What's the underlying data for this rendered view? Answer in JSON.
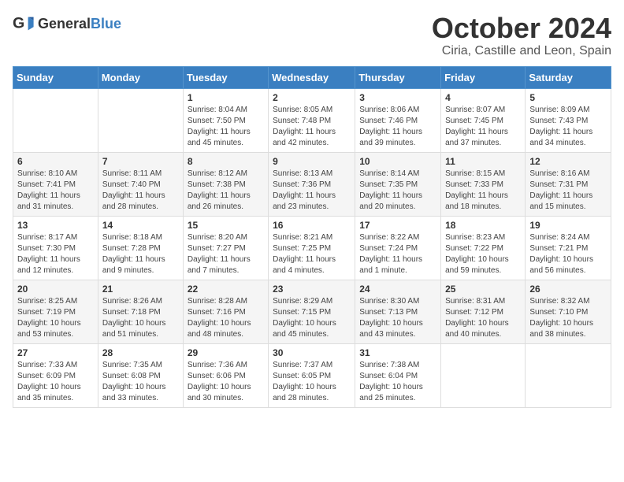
{
  "logo": {
    "text_general": "General",
    "text_blue": "Blue"
  },
  "header": {
    "month": "October 2024",
    "location": "Ciria, Castille and Leon, Spain"
  },
  "weekdays": [
    "Sunday",
    "Monday",
    "Tuesday",
    "Wednesday",
    "Thursday",
    "Friday",
    "Saturday"
  ],
  "weeks": [
    [
      {
        "day": "",
        "info": ""
      },
      {
        "day": "",
        "info": ""
      },
      {
        "day": "1",
        "info": "Sunrise: 8:04 AM\nSunset: 7:50 PM\nDaylight: 11 hours and 45 minutes."
      },
      {
        "day": "2",
        "info": "Sunrise: 8:05 AM\nSunset: 7:48 PM\nDaylight: 11 hours and 42 minutes."
      },
      {
        "day": "3",
        "info": "Sunrise: 8:06 AM\nSunset: 7:46 PM\nDaylight: 11 hours and 39 minutes."
      },
      {
        "day": "4",
        "info": "Sunrise: 8:07 AM\nSunset: 7:45 PM\nDaylight: 11 hours and 37 minutes."
      },
      {
        "day": "5",
        "info": "Sunrise: 8:09 AM\nSunset: 7:43 PM\nDaylight: 11 hours and 34 minutes."
      }
    ],
    [
      {
        "day": "6",
        "info": "Sunrise: 8:10 AM\nSunset: 7:41 PM\nDaylight: 11 hours and 31 minutes."
      },
      {
        "day": "7",
        "info": "Sunrise: 8:11 AM\nSunset: 7:40 PM\nDaylight: 11 hours and 28 minutes."
      },
      {
        "day": "8",
        "info": "Sunrise: 8:12 AM\nSunset: 7:38 PM\nDaylight: 11 hours and 26 minutes."
      },
      {
        "day": "9",
        "info": "Sunrise: 8:13 AM\nSunset: 7:36 PM\nDaylight: 11 hours and 23 minutes."
      },
      {
        "day": "10",
        "info": "Sunrise: 8:14 AM\nSunset: 7:35 PM\nDaylight: 11 hours and 20 minutes."
      },
      {
        "day": "11",
        "info": "Sunrise: 8:15 AM\nSunset: 7:33 PM\nDaylight: 11 hours and 18 minutes."
      },
      {
        "day": "12",
        "info": "Sunrise: 8:16 AM\nSunset: 7:31 PM\nDaylight: 11 hours and 15 minutes."
      }
    ],
    [
      {
        "day": "13",
        "info": "Sunrise: 8:17 AM\nSunset: 7:30 PM\nDaylight: 11 hours and 12 minutes."
      },
      {
        "day": "14",
        "info": "Sunrise: 8:18 AM\nSunset: 7:28 PM\nDaylight: 11 hours and 9 minutes."
      },
      {
        "day": "15",
        "info": "Sunrise: 8:20 AM\nSunset: 7:27 PM\nDaylight: 11 hours and 7 minutes."
      },
      {
        "day": "16",
        "info": "Sunrise: 8:21 AM\nSunset: 7:25 PM\nDaylight: 11 hours and 4 minutes."
      },
      {
        "day": "17",
        "info": "Sunrise: 8:22 AM\nSunset: 7:24 PM\nDaylight: 11 hours and 1 minute."
      },
      {
        "day": "18",
        "info": "Sunrise: 8:23 AM\nSunset: 7:22 PM\nDaylight: 10 hours and 59 minutes."
      },
      {
        "day": "19",
        "info": "Sunrise: 8:24 AM\nSunset: 7:21 PM\nDaylight: 10 hours and 56 minutes."
      }
    ],
    [
      {
        "day": "20",
        "info": "Sunrise: 8:25 AM\nSunset: 7:19 PM\nDaylight: 10 hours and 53 minutes."
      },
      {
        "day": "21",
        "info": "Sunrise: 8:26 AM\nSunset: 7:18 PM\nDaylight: 10 hours and 51 minutes."
      },
      {
        "day": "22",
        "info": "Sunrise: 8:28 AM\nSunset: 7:16 PM\nDaylight: 10 hours and 48 minutes."
      },
      {
        "day": "23",
        "info": "Sunrise: 8:29 AM\nSunset: 7:15 PM\nDaylight: 10 hours and 45 minutes."
      },
      {
        "day": "24",
        "info": "Sunrise: 8:30 AM\nSunset: 7:13 PM\nDaylight: 10 hours and 43 minutes."
      },
      {
        "day": "25",
        "info": "Sunrise: 8:31 AM\nSunset: 7:12 PM\nDaylight: 10 hours and 40 minutes."
      },
      {
        "day": "26",
        "info": "Sunrise: 8:32 AM\nSunset: 7:10 PM\nDaylight: 10 hours and 38 minutes."
      }
    ],
    [
      {
        "day": "27",
        "info": "Sunrise: 7:33 AM\nSunset: 6:09 PM\nDaylight: 10 hours and 35 minutes."
      },
      {
        "day": "28",
        "info": "Sunrise: 7:35 AM\nSunset: 6:08 PM\nDaylight: 10 hours and 33 minutes."
      },
      {
        "day": "29",
        "info": "Sunrise: 7:36 AM\nSunset: 6:06 PM\nDaylight: 10 hours and 30 minutes."
      },
      {
        "day": "30",
        "info": "Sunrise: 7:37 AM\nSunset: 6:05 PM\nDaylight: 10 hours and 28 minutes."
      },
      {
        "day": "31",
        "info": "Sunrise: 7:38 AM\nSunset: 6:04 PM\nDaylight: 10 hours and 25 minutes."
      },
      {
        "day": "",
        "info": ""
      },
      {
        "day": "",
        "info": ""
      }
    ]
  ]
}
